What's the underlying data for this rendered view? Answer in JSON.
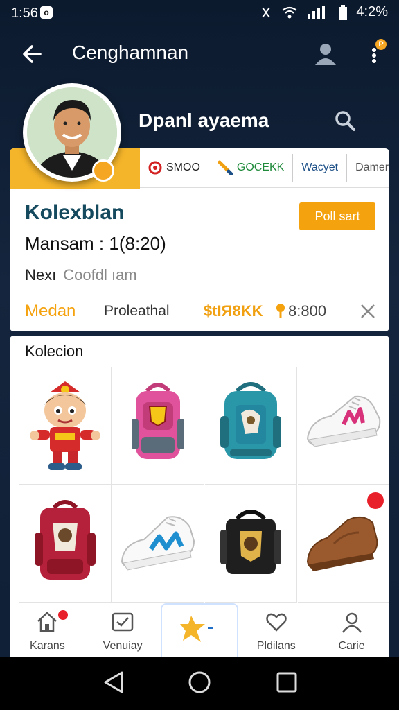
{
  "status_bar": {
    "time": "1:56",
    "battery": "4:2%"
  },
  "app_bar": {
    "title": "Cenghamnan"
  },
  "profile": {
    "username": "Dpanl ayaema"
  },
  "card": {
    "tabs": [
      {
        "label": "SMOO",
        "icon": "target-icon",
        "color": "#d32020"
      },
      {
        "label": "GOCEKK",
        "icon": "pencil-icon",
        "color": "#1e8a3a"
      },
      {
        "label": "Wacyet",
        "icon": "",
        "color": "#1b4f86"
      },
      {
        "label": "Damer",
        "icon": "",
        "color": "#555555"
      }
    ],
    "heading": "Kolexblan",
    "button": "Poll sart",
    "meta": "Mansam : 1(8:20)",
    "next_label": "Nexı",
    "next_placeholder": "Coofdl ıam",
    "row": {
      "m1": "Medan",
      "m2": "Proleathal",
      "m3": "$tIЯ8KK",
      "m4": "8:800"
    }
  },
  "collection": {
    "title": "Kolecion",
    "items": [
      {
        "name": "toy-figure"
      },
      {
        "name": "pink-backpack"
      },
      {
        "name": "teal-backpack"
      },
      {
        "name": "white-pink-sneaker"
      },
      {
        "name": "red-backpack"
      },
      {
        "name": "white-blue-sneaker"
      },
      {
        "name": "black-bag"
      },
      {
        "name": "brown-shoe"
      }
    ]
  },
  "bottom_nav": [
    {
      "label": "Karans",
      "icon": "home-icon"
    },
    {
      "label": "Venuiay",
      "icon": "inbox-icon"
    },
    {
      "label": "",
      "icon": "star-icon"
    },
    {
      "label": "Pldilans",
      "icon": "heart-icon"
    },
    {
      "label": "Carie",
      "icon": "profile-icon"
    }
  ],
  "colors": {
    "accent": "#f5a20f",
    "heading": "#14495e",
    "badge": "#e8202a"
  }
}
